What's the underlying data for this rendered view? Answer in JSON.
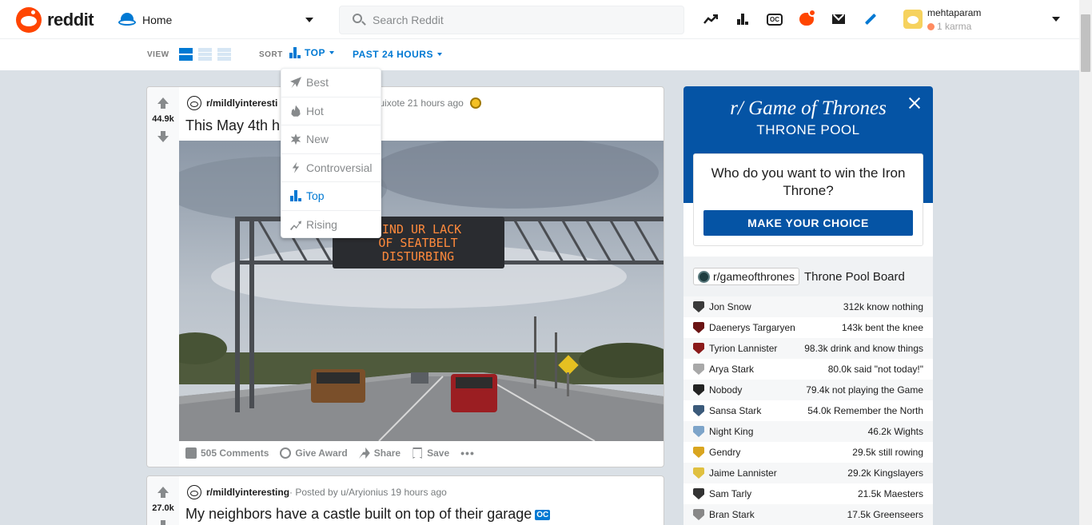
{
  "header": {
    "brand": "reddit",
    "home_label": "Home",
    "search_placeholder": "Search Reddit",
    "username": "mehtaparam",
    "karma": "1 karma"
  },
  "sortbar": {
    "view_label": "VIEW",
    "sort_label": "SORT",
    "sort_value": "TOP",
    "time_value": "PAST 24 HOURS"
  },
  "sort_menu": {
    "items": [
      {
        "label": "Best",
        "icon": "rocket-icon",
        "active": false
      },
      {
        "label": "Hot",
        "icon": "flame-icon",
        "active": false
      },
      {
        "label": "New",
        "icon": "sparkle-icon",
        "active": false
      },
      {
        "label": "Controversial",
        "icon": "lightning-icon",
        "active": false
      },
      {
        "label": "Top",
        "icon": "bar-chart-icon",
        "active": true
      },
      {
        "label": "Rising",
        "icon": "trend-up-icon",
        "active": false
      }
    ]
  },
  "posts": [
    {
      "score": "44.9k",
      "subreddit": "r/mildlyinteresti",
      "posted_by": "uixote 21 hours ago",
      "title": "This May 4th h",
      "image_sign": [
        "FIND UR LACK",
        "OF SEATBELT",
        "DISTURBING"
      ],
      "actions": {
        "comments": "505 Comments",
        "award": "Give Award",
        "share": "Share",
        "save": "Save",
        "more": "•••"
      }
    },
    {
      "score": "27.0k",
      "subreddit": "r/mildlyinteresting",
      "posted_by": " · Posted by u/Aryionius 19 hours ago",
      "title": "My neighbors have a castle built on top of their garage",
      "tag": "OC"
    }
  ],
  "sidebar": {
    "banner_logo": "r/ Game of Thrones",
    "banner_sub": "THRONE POOL",
    "question": "Who do you want to win the Iron Throne?",
    "button": "MAKE YOUR CHOICE",
    "board_sub": "r/gameofthrones",
    "board_title": "Throne Pool Board",
    "rows": [
      {
        "name": "Jon Snow",
        "stat": "312k know nothing",
        "color": "#3a3a3a"
      },
      {
        "name": "Daenerys Targaryen",
        "stat": "143k bent the knee",
        "color": "#6b1414"
      },
      {
        "name": "Tyrion Lannister",
        "stat": "98.3k drink and know things",
        "color": "#8b1a1a"
      },
      {
        "name": "Arya Stark",
        "stat": "80.0k said \"not today!\"",
        "color": "#a8a8a8"
      },
      {
        "name": "Nobody",
        "stat": "79.4k not playing the Game",
        "color": "#222222"
      },
      {
        "name": "Sansa Stark",
        "stat": "54.0k Remember the North",
        "color": "#3b5a7a"
      },
      {
        "name": "Night King",
        "stat": "46.2k Wights",
        "color": "#7da4c9"
      },
      {
        "name": "Gendry",
        "stat": "29.5k still rowing",
        "color": "#d9a520"
      },
      {
        "name": "Jaime Lannister",
        "stat": "29.2k Kingslayers",
        "color": "#e0c040"
      },
      {
        "name": "Sam Tarly",
        "stat": "21.5k Maesters",
        "color": "#333333"
      },
      {
        "name": "Bran Stark",
        "stat": "17.5k Greenseers",
        "color": "#888888"
      }
    ]
  }
}
